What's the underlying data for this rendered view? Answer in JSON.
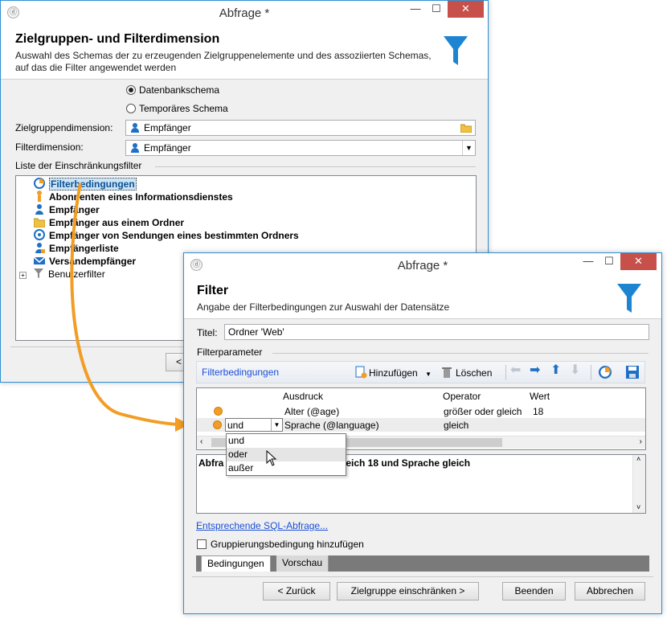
{
  "win1": {
    "title": "Abfrage *",
    "header_title": "Zielgruppen- und Filterdimension",
    "header_sub": "Auswahl des Schemas der zu erzeugenden Zielgruppenelemente und des assoziierten Schemas, auf das die Filter angewendet werden",
    "radio_db": "Datenbankschema",
    "radio_temp": "Temporäres Schema",
    "label_target": "Zielgruppendimension:",
    "value_target": "Empfänger",
    "label_filter": "Filterdimension:",
    "value_filter": "Empfänger",
    "list_label": "Liste der Einschränkungsfilter",
    "items": [
      "Filterbedingungen",
      "Abonnenten eines Informationsdienstes",
      "Empfänger",
      "Empfänger aus einem Ordner",
      "Empfänger von Sendungen eines bestimmten Ordners",
      "Empfängerliste",
      "Versandempfänger",
      "Benutzerfilter"
    ],
    "back_partial": "<"
  },
  "win2": {
    "title": "Abfrage *",
    "header_title": "Filter",
    "header_sub": "Angabe der Filterbedingungen zur Auswahl der Datensätze",
    "label_title": "Titel:",
    "value_title": "Ordner 'Web'",
    "params_label": "Filterparameter",
    "toolbar": {
      "tab": "Filterbedingungen",
      "add": "Hinzufügen",
      "delete": "Löschen"
    },
    "columns": [
      "Ausdruck",
      "Operator",
      "Wert"
    ],
    "rows": [
      {
        "logic": "",
        "expr": "Alter (@age)",
        "op": "größer oder gleich",
        "val": "18"
      },
      {
        "logic": "und",
        "expr": "Sprache (@language)",
        "op": "gleich",
        "val": ""
      }
    ],
    "dropdown_options": [
      "und",
      "oder",
      "außer"
    ],
    "preview_prefix": "Abfra",
    "preview_suffix": "leich 18 und Sprache gleich",
    "sql_link": "Entsprechende SQL-Abfrage...",
    "group_check": "Gruppierungsbedingung hinzufügen",
    "tabs": [
      "Bedingungen",
      "Vorschau"
    ],
    "buttons": {
      "back": "< Zurück",
      "restrict": "Zielgruppe einschränken >",
      "finish": "Beenden",
      "cancel": "Abbrechen"
    }
  },
  "colors": {
    "accent": "#1d84d1",
    "close": "#c7504b",
    "arrow": "#f29d24"
  }
}
